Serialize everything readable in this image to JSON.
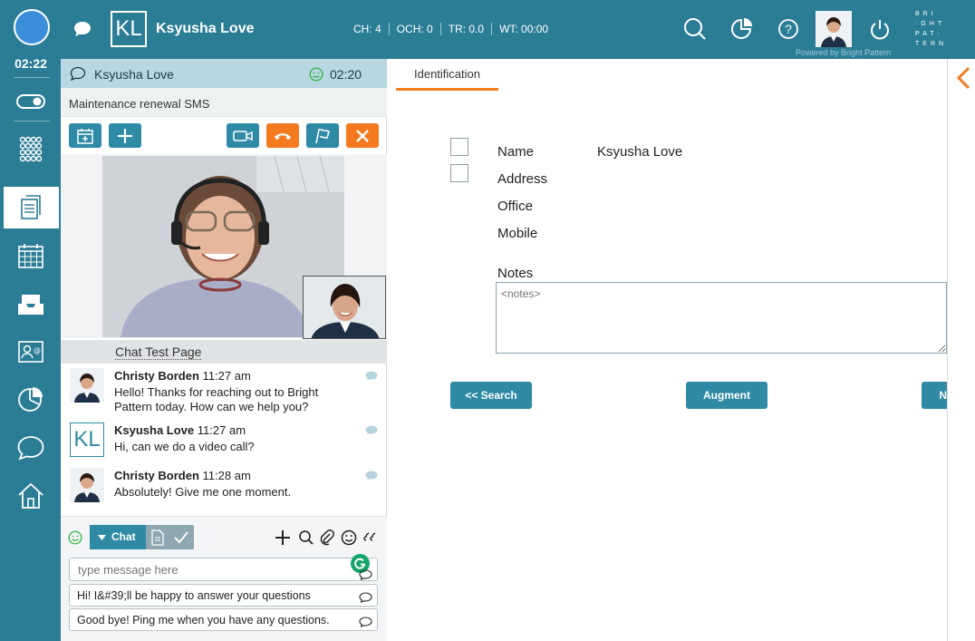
{
  "topbar": {
    "time": "02:22",
    "initials": "KL",
    "customer_name": "Ksyusha Love",
    "stats": [
      "CH: 4",
      "OCH: 0",
      "TR: 0.0",
      "WT: 00:00"
    ],
    "brand_lines": [
      "BRI",
      "·GHT",
      "PAT·",
      "TERN"
    ],
    "powered_by": "Powered by Bright Pattern",
    "icons": [
      "search-icon",
      "chart-icon",
      "help-icon",
      "avatar",
      "power-icon"
    ]
  },
  "leftnav": {
    "items": [
      "toggle-icon",
      "dialpad-icon",
      "contact-info-icon",
      "calendar-icon",
      "inbox-icon",
      "directory-icon",
      "reports-icon",
      "chat-icon",
      "home-icon"
    ],
    "active": "contact-info-icon"
  },
  "interaction": {
    "header_name": "Ksyusha Love",
    "header_timer": "02:20",
    "subject": "Maintenance renewal SMS",
    "chat_title": "Chat Test Page",
    "messages": [
      {
        "author": "Christy Borden",
        "time": "11:27 am",
        "text": "Hello! Thanks for reaching out to Bright Pattern today. How can we help you?"
      },
      {
        "author": "Ksyusha Love",
        "time": "11:27 am",
        "text": "Hi, can we do a video call?",
        "initials": "KL"
      },
      {
        "author": "Christy Borden",
        "time": "11:28 am",
        "text": "Absolutely! Give me one moment."
      }
    ],
    "chat_mode": "Chat",
    "input_placeholder": "type message here",
    "canned_responses": [
      "Hi! I&#39;ll be happy to answer your questions",
      "Good bye! Ping me when you have any questions."
    ]
  },
  "workspace": {
    "tab": "Identification",
    "fields": [
      {
        "label": "Name",
        "value": "Ksyusha Love"
      },
      {
        "label": "Address",
        "value": ""
      },
      {
        "label": "Office",
        "value": ""
      },
      {
        "label": "Mobile",
        "value": ""
      }
    ],
    "notes_label": "Notes",
    "notes_placeholder": "<notes>",
    "buttons": {
      "search": "<< Search",
      "augment": "Augment",
      "third": "N"
    }
  },
  "colors": {
    "brand": "#2b7d96",
    "accent": "#f47a20",
    "button": "#2e8aa5"
  }
}
